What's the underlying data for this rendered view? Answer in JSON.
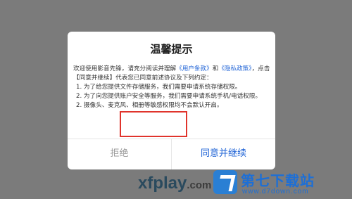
{
  "background_logo": {
    "brand": "xfplay",
    "domain": ".com"
  },
  "dialog": {
    "title": "温馨提示",
    "intro_part1": "欢迎使用影音先锋，请充分阅读并理解",
    "terms_link": "《用户条款》",
    "and_text": "和",
    "privacy_link": "《隐私政策》",
    "intro_part2": "，点击【同意并继续】代表您已同意前述协议及下列约定：",
    "items": [
      "1. 为了给您提供文件存储服务，我们需要申请系统存储权限。",
      "2. 为了向您提供账户安全等服务，我们需要申请系统手机/电话权限。",
      "2. 摄像头、麦克风、相册等敏感权限均不会默认开启。"
    ],
    "reject_label": "拒绝",
    "accept_label": "同意并继续"
  },
  "watermark": {
    "title": "第七下载站",
    "url": "www.d7down.com"
  },
  "colors": {
    "link": "#1f63d6",
    "highlight_box": "#e0342c",
    "overlay": "#7b7b7b"
  }
}
